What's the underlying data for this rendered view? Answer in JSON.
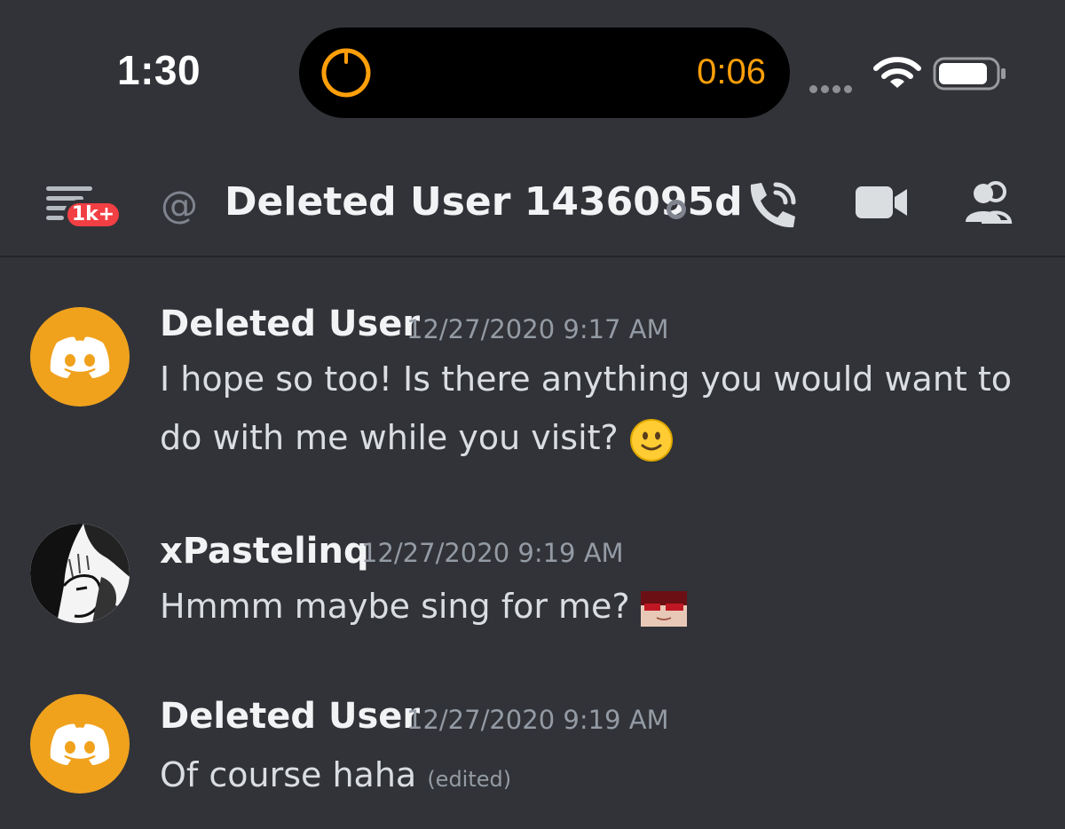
{
  "status_bar": {
    "time": "1:30",
    "activity_timer": "0:06",
    "icons": [
      "signal-dots-icon",
      "wifi-icon",
      "battery-icon"
    ]
  },
  "header": {
    "unread_badge": "1k+",
    "at_symbol": "@",
    "channel_name": "Deleted User 1436095d",
    "icons": [
      "menu-icon",
      "at-icon",
      "call-icon",
      "video-icon",
      "members-icon"
    ]
  },
  "messages": [
    {
      "username": "Deleted User",
      "timestamp": "12/27/2020 9:17 AM",
      "text_line1": "I hope so too! Is there anything you would want to",
      "text_line2": "do with me while you visit?",
      "emoji": "slightly-smiling-face"
    },
    {
      "username": "xPastelinq",
      "timestamp": "12/27/2020 9:19 AM",
      "text": "Hmmm maybe sing for me?",
      "emoji": "custom-emoji"
    },
    {
      "username": "Deleted User",
      "timestamp": "12/27/2020 9:19 AM",
      "text": "Of course haha",
      "edited_label": "(edited)"
    }
  ],
  "colors": {
    "background": "#313338",
    "accent_badge": "#f23f43",
    "discord_avatar": "#f0a21d",
    "timer": "#ff9f0a"
  }
}
